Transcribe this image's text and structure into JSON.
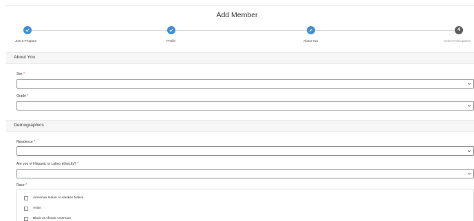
{
  "page": {
    "title": "Add Member"
  },
  "stepper": {
    "steps": [
      {
        "label": "Join a Program",
        "state": "done",
        "number": ""
      },
      {
        "label": "Profile",
        "state": "done",
        "number": ""
      },
      {
        "label": "About You",
        "state": "current",
        "number": ""
      },
      {
        "label": "Select Participation",
        "state": "pending",
        "number": "4"
      }
    ]
  },
  "about": {
    "heading": "About You",
    "sex_label": "Sex",
    "grade_label": "Grade",
    "required_mark": "*"
  },
  "demographics": {
    "heading": "Demographics",
    "residence_label": "Residence",
    "hispanic_label": "Are you of Hispanic or Latino ethnicity?",
    "race_label": "Race",
    "race_options": [
      "American Indian or Alaskan Native",
      "Asian",
      "Black or African American"
    ]
  },
  "colors": {
    "accent": "#3f8fd6",
    "pending": "#5f5f5f",
    "required": "#c23934"
  }
}
